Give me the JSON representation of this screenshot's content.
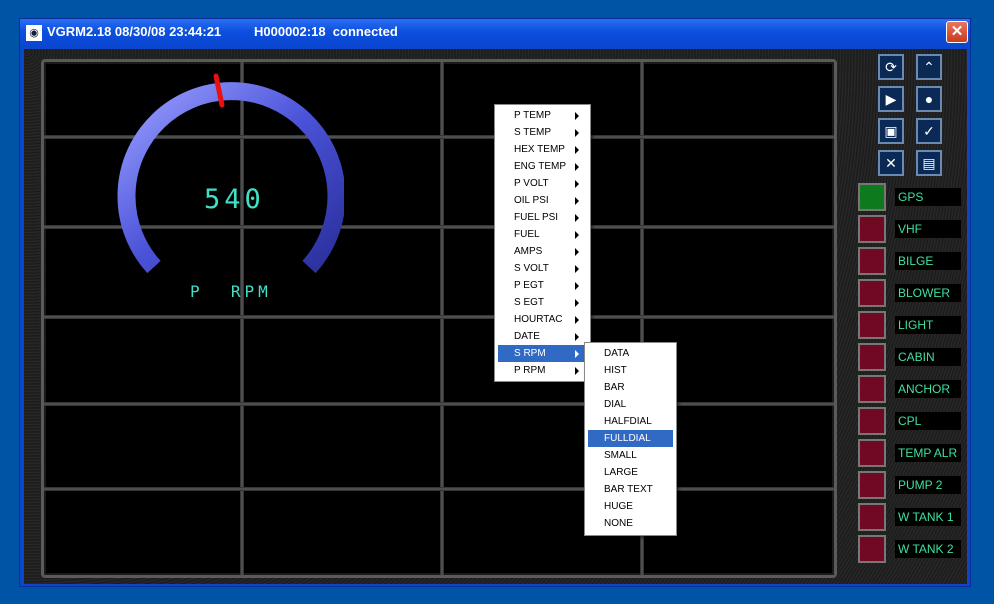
{
  "window": {
    "title": "VGRM2.18 08/30/08 23:44:21",
    "status": "H000002:18  connected",
    "icon": "gauge-app-icon",
    "close_label": "✕"
  },
  "gauge": {
    "value": "540",
    "label": "P  RPM",
    "colors": {
      "arc": "#5a62e8",
      "needle": "#e81010",
      "text": "#3fe0c6"
    }
  },
  "context_menu": {
    "items": [
      "P TEMP",
      "S TEMP",
      "HEX TEMP",
      "ENG TEMP",
      "P VOLT",
      "OIL PSI",
      "FUEL PSI",
      "FUEL",
      "AMPS",
      "S VOLT",
      "P EGT",
      "S EGT",
      "HOURTAC",
      "DATE",
      "S RPM",
      "P RPM"
    ],
    "selected": "S RPM"
  },
  "submenu": {
    "items": [
      "DATA",
      "HIST",
      "BAR",
      "DIAL",
      "HALFDIAL",
      "FULLDIAL",
      "SMALL",
      "LARGE",
      "BAR TEXT",
      "HUGE",
      "NONE"
    ],
    "selected": "FULLDIAL"
  },
  "toolbar": {
    "buttons": [
      {
        "icon": "refresh-icon",
        "glyph": "⟳"
      },
      {
        "icon": "chart-icon",
        "glyph": "⌃"
      },
      {
        "icon": "play-icon",
        "glyph": "▶"
      },
      {
        "icon": "record-icon",
        "glyph": "●"
      },
      {
        "icon": "save-icon",
        "glyph": "▣"
      },
      {
        "icon": "check-icon",
        "glyph": "✓"
      },
      {
        "icon": "close-box-icon",
        "glyph": "✕"
      },
      {
        "icon": "document-icon",
        "glyph": "▤"
      }
    ]
  },
  "switches": [
    {
      "label": "GPS",
      "on": true
    },
    {
      "label": "VHF",
      "on": false
    },
    {
      "label": "BILGE",
      "on": false
    },
    {
      "label": "BLOWER",
      "on": false
    },
    {
      "label": "LIGHT",
      "on": false
    },
    {
      "label": "CABIN",
      "on": false
    },
    {
      "label": "ANCHOR",
      "on": false
    },
    {
      "label": "CPL",
      "on": false
    },
    {
      "label": "TEMP ALR",
      "on": false
    },
    {
      "label": "PUMP 2",
      "on": false
    },
    {
      "label": "W TANK 1",
      "on": false
    },
    {
      "label": "W TANK 2",
      "on": false
    }
  ]
}
